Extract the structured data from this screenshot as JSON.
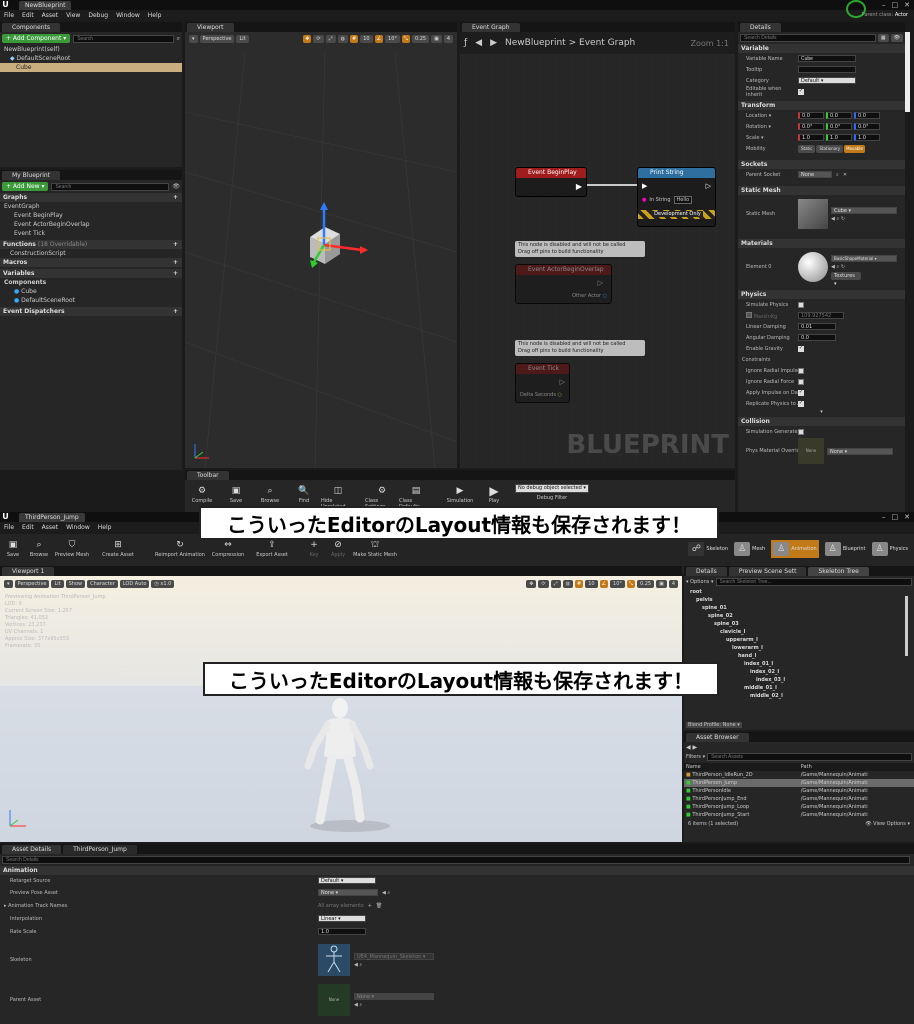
{
  "top_window": {
    "title_tab": "NewBlueprint",
    "parent_class_label": "Parent class:",
    "parent_class_value": "Actor",
    "menu": [
      "File",
      "Edit",
      "Asset",
      "View",
      "Debug",
      "Window",
      "Help"
    ],
    "components": {
      "tab": "Components",
      "add_button": "+ Add Component ▾",
      "search_placeholder": "Search",
      "self_item": "NewBlueprint(self)",
      "root": "DefaultSceneRoot",
      "cube": "Cube"
    },
    "my_blueprint": {
      "tab": "My Blueprint",
      "add_button": "+ Add New ▾",
      "search_placeholder": "Search",
      "graphs_label": "Graphs",
      "event_graph": "EventGraph",
      "events": [
        "Event BeginPlay",
        "Event ActorBeginOverlap",
        "Event Tick"
      ],
      "functions_label": "Functions",
      "functions_overridable": "(18 Overridable)",
      "construction_script": "ConstructionScript",
      "macros_label": "Macros",
      "variables_label": "Variables",
      "components_label": "Components",
      "var_components": [
        "Cube",
        "DefaultSceneRoot"
      ],
      "dispatchers_label": "Event Dispatchers"
    },
    "viewport": {
      "tab": "Viewport",
      "perspective": "Perspective",
      "lit": "Lit",
      "snap_grid": "10",
      "snap_rot": "10°",
      "snap_scale": "0.25",
      "cam_speed": "4"
    },
    "event_graph": {
      "tab": "Event Graph",
      "breadcrumb_bp": "NewBlueprint",
      "breadcrumb_sep": ">",
      "breadcrumb_graph": "Event Graph",
      "zoom": "Zoom 1:1",
      "watermark": "BLUEPRINT",
      "node_begin": "Event BeginPlay",
      "node_print": "Print String",
      "in_string_label": "In String",
      "in_string_value": "Hello",
      "dev_only": "Development Only",
      "disabled_tip_1a": "This node is disabled and will not be called",
      "disabled_tip_1b": "Drag off pins to build functionality",
      "node_overlap": "Event ActorBeginOverlap",
      "other_actor": "Other Actor",
      "disabled_tip_2a": "This node is disabled and will not be called",
      "disabled_tip_2b": "Drag off pins to build functionality",
      "node_tick": "Event Tick",
      "delta_seconds": "Delta Seconds"
    },
    "details": {
      "tab": "Details",
      "search_placeholder": "Search Details",
      "variable_section": "Variable",
      "variable_name_label": "Variable Name",
      "variable_name_value": "Cube",
      "tooltip_label": "Tooltip",
      "category_label": "Category",
      "category_value": "Default",
      "editable_label": "Editable when Inherit",
      "transform_section": "Transform",
      "location_label": "Location ▾",
      "rotation_label": "Rotation ▾",
      "scale_label": "Scale ▾",
      "loc_values": [
        "0.0",
        "0.0",
        "0.0"
      ],
      "rot_values": [
        "0.0°",
        "0.0°",
        "0.0°"
      ],
      "scale_values": [
        "1.0",
        "1.0",
        "1.0"
      ],
      "mobility_label": "Mobility",
      "mobility_options": [
        "Static",
        "Stationary",
        "Movable"
      ],
      "sockets_section": "Sockets",
      "parent_socket_label": "Parent Socket",
      "parent_socket_value": "None",
      "static_mesh_section": "Static Mesh",
      "static_mesh_label": "Static Mesh",
      "static_mesh_value": "Cube",
      "materials_section": "Materials",
      "element0_label": "Element 0",
      "element0_value": "BasicShapeMaterial",
      "textures_button": "Textures ▾",
      "physics_section": "Physics",
      "simulate_physics": "Simulate Physics",
      "mass_label": "MassInKg",
      "mass_value": "109.927542",
      "linear_damping_label": "Linear Damping",
      "linear_damping_value": "0.01",
      "angular_damping_label": "Angular Damping",
      "angular_damping_value": "0.0",
      "enable_gravity": "Enable Gravity",
      "constraints_label": "Constraints",
      "ignore_radial_impulse": "Ignore Radial Impulse",
      "ignore_radial_force": "Ignore Radial Force",
      "apply_impulse": "Apply Impulse on Damage",
      "replicate_physics": "Replicate Physics to Autonomous Proxy",
      "collision_section": "Collision",
      "simulation_generates": "Simulation Generates Hit Events",
      "phys_material_label": "Phys Material Override",
      "phys_material_value": "None",
      "none_thumb": "None"
    },
    "toolbar": {
      "tab": "Toolbar",
      "items": [
        "Compile",
        "Save",
        "Browse",
        "Find",
        "Hide Unrelated",
        "Class Settings",
        "Class Defaults",
        "Simulation",
        "Play"
      ],
      "debug_filter": "No debug object selected ▾",
      "debug_filter_label": "Debug Filter"
    }
  },
  "banner_text": "こういったEditorのLayout情報も保存されます！",
  "bottom_window": {
    "title_tab": "ThirdPerson_Jump",
    "menu": [
      "File",
      "Edit",
      "Asset",
      "Window",
      "Help"
    ],
    "toolbar": [
      "Save",
      "Browse",
      "Preview Mesh",
      "Create Asset",
      "Reimport Animation",
      "Compression",
      "Export Asset",
      "Key",
      "Apply",
      "Make Static Mesh"
    ],
    "modes": [
      "Skeleton",
      "Mesh",
      "Animation",
      "Blueprint",
      "Physics"
    ],
    "viewport": {
      "tab": "Viewport 1",
      "perspective": "Perspective",
      "lit": "Lit",
      "show": "Show",
      "character": "Character",
      "lod": "LOD Auto",
      "speed": "x1.0",
      "snap_grid": "10",
      "snap_rot": "10°",
      "snap_scale": "0.25",
      "cam_speed": "4",
      "stats": [
        "Previewing Animation ThirdPerson_Jump",
        "LOD: 0",
        "Current Screen Size: 1.257",
        "Triangles: 41,052",
        "Vertices: 23,237",
        "UV Channels: 1",
        "Approx Size: 377x95x353",
        "Framerate: 35"
      ]
    },
    "skeleton_tabs": [
      "Details",
      "Preview Scene Sett",
      "Skeleton Tree"
    ],
    "skeleton_options": "▾ Options ▾",
    "skeleton_search": "Search Skeleton Tree...",
    "bones": [
      "root",
      "pelvis",
      "spine_01",
      "spine_02",
      "spine_03",
      "clavicle_l",
      "upperarm_l",
      "lowerarm_l",
      "hand_l",
      "index_01_l",
      "index_02_l",
      "index_03_l",
      "middle_01_l",
      "middle_02_l"
    ],
    "blend_profile": "Blend Profile: None ▾",
    "asset_browser": {
      "tab": "Asset Browser",
      "filters": "Filters ▾",
      "search_placeholder": "Search Assets",
      "col_name": "Name",
      "col_path": "Path",
      "rows": [
        {
          "name": "ThirdPerson_IdleRun_2D",
          "path": "/Game/Mannequin/Animati"
        },
        {
          "name": "ThirdPerson_Jump",
          "path": "/Game/Mannequin/Animati"
        },
        {
          "name": "ThirdPersonIdle",
          "path": "/Game/Mannequin/Animati"
        },
        {
          "name": "ThirdPersonJump_End",
          "path": "/Game/Mannequin/Animati"
        },
        {
          "name": "ThirdPersonJump_Loop",
          "path": "/Game/Mannequin/Animati"
        },
        {
          "name": "ThirdPersonJump_Start",
          "path": "/Game/Mannequin/Animati"
        }
      ],
      "count": "6 items (1 selected)",
      "view_options": "View Options ▾"
    },
    "asset_details": {
      "tabs": [
        "Asset Details",
        "ThirdPerson_Jump"
      ],
      "search_placeholder": "Search Details",
      "section": "Animation",
      "retarget_label": "Retarget Source",
      "retarget_value": "Default",
      "preview_pose_label": "Preview Pose Asset",
      "preview_pose_value": "None",
      "track_names_label": "Animation Track Names",
      "track_names_value": "All array elements",
      "interpolation_label": "Interpolation",
      "interpolation_value": "Linear",
      "rate_scale_label": "Rate Scale",
      "rate_scale_value": "1.0",
      "skeleton_label": "Skeleton",
      "skeleton_value": "UE4_Mannequin_Skeleton",
      "parent_asset_label": "Parent Asset",
      "parent_asset_value": "None",
      "none_thumb": "None"
    }
  }
}
